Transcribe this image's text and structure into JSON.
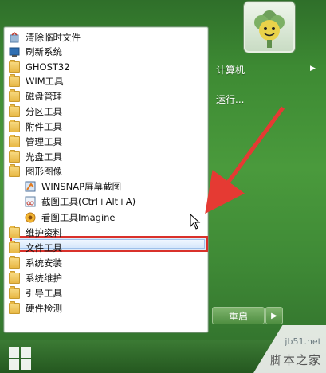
{
  "start_menu": {
    "programs": [
      {
        "label": "清除临时文件",
        "icon": "cleanup-icon"
      },
      {
        "label": "刷新系统",
        "icon": "refresh-system-icon"
      },
      {
        "label": "GHOST32",
        "icon": "folder-icon"
      },
      {
        "label": "WIM工具",
        "icon": "folder-icon"
      },
      {
        "label": "磁盘管理",
        "icon": "folder-icon"
      },
      {
        "label": "分区工具",
        "icon": "folder-icon"
      },
      {
        "label": "附件工具",
        "icon": "folder-icon"
      },
      {
        "label": "管理工具",
        "icon": "folder-icon"
      },
      {
        "label": "光盘工具",
        "icon": "folder-icon"
      },
      {
        "label": "图形图像",
        "icon": "folder-icon"
      },
      {
        "label": "WINSNAP屏幕截图",
        "icon": "winsnap-icon"
      },
      {
        "label": "截图工具(Ctrl+Alt+A)",
        "icon": "snipping-tool-icon"
      },
      {
        "label": "看图工具Imagine",
        "icon": "imagine-icon"
      },
      {
        "label": "维护资料",
        "icon": "folder-icon"
      },
      {
        "label": "文件工具",
        "icon": "folder-icon"
      },
      {
        "label": "系统安装",
        "icon": "folder-icon"
      },
      {
        "label": "系统维护",
        "icon": "folder-icon"
      },
      {
        "label": "引导工具",
        "icon": "folder-icon"
      },
      {
        "label": "硬件检测",
        "icon": "folder-icon"
      }
    ],
    "right_panel": {
      "computer": "计算机",
      "run": "运行..."
    },
    "restart_button": "重启"
  },
  "watermark": {
    "site": "jb51.net",
    "name": "脚本之家"
  },
  "colors": {
    "desktop_green": "#3d8a33",
    "highlight_border": "#d9312b",
    "arrow_red": "#e53a33"
  }
}
